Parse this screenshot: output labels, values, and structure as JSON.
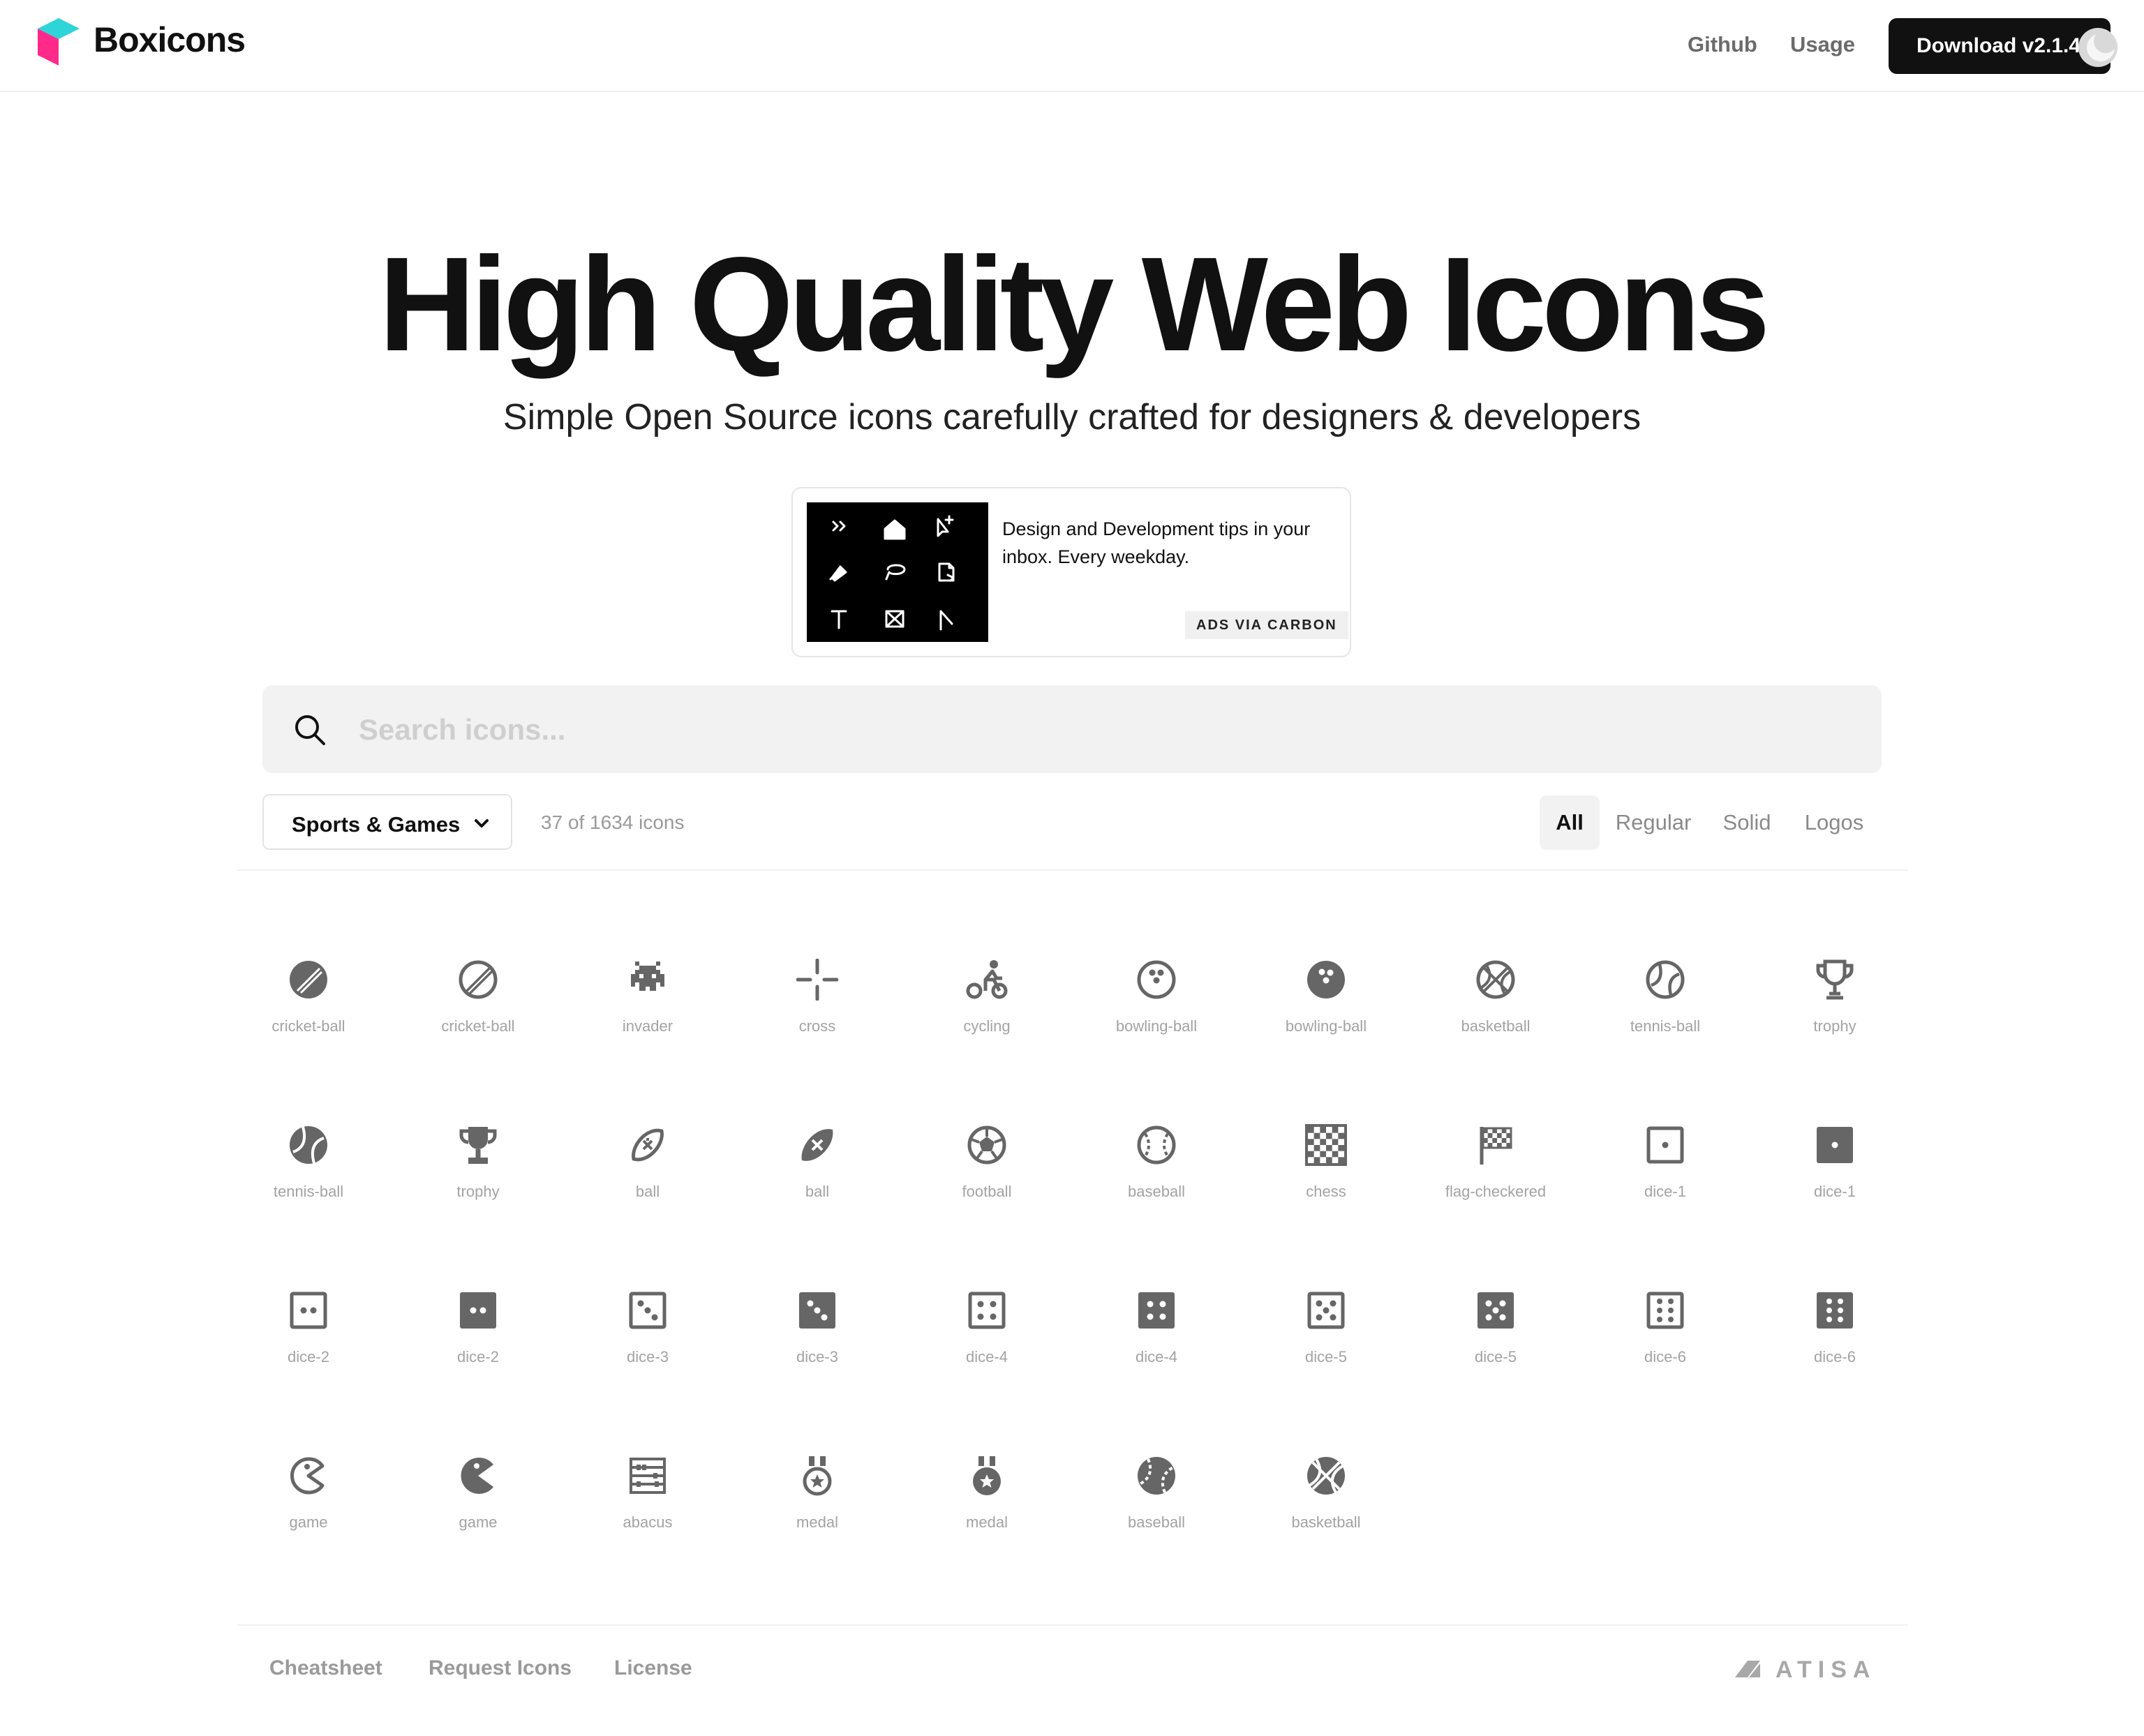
{
  "header": {
    "brand": "Boxicons",
    "nav": [
      {
        "label": "Github"
      },
      {
        "label": "Usage"
      }
    ],
    "download_label": "Download v2.1.4",
    "brand_colors": {
      "top": "#2dd4d8",
      "left": "#ff2a8a",
      "right": "#c01470"
    }
  },
  "hero": {
    "title": "High Quality Web Icons",
    "subtitle": "Simple Open Source icons carefully crafted for designers & developers"
  },
  "ad": {
    "text": "Design and Development tips in your inbox. Every weekday.",
    "badge": "ADS VIA CARBON"
  },
  "search": {
    "placeholder": "Search icons..."
  },
  "filters": {
    "category": "Sports & Games",
    "count_text": "37 of 1634 icons",
    "tabs": [
      {
        "label": "All",
        "active": true
      },
      {
        "label": "Regular",
        "active": false
      },
      {
        "label": "Solid",
        "active": false
      },
      {
        "label": "Logos",
        "active": false
      }
    ]
  },
  "icons": [
    {
      "name": "cricket-ball",
      "icon": "cricket-ball-solid-icon"
    },
    {
      "name": "cricket-ball",
      "icon": "cricket-ball-regular-icon"
    },
    {
      "name": "invader",
      "icon": "invader-icon"
    },
    {
      "name": "cross",
      "icon": "cross-icon"
    },
    {
      "name": "cycling",
      "icon": "cycling-icon"
    },
    {
      "name": "bowling-ball",
      "icon": "bowling-ball-regular-icon"
    },
    {
      "name": "bowling-ball",
      "icon": "bowling-ball-solid-icon"
    },
    {
      "name": "basketball",
      "icon": "basketball-regular-icon"
    },
    {
      "name": "tennis-ball",
      "icon": "tennis-ball-regular-icon"
    },
    {
      "name": "trophy",
      "icon": "trophy-regular-icon"
    },
    {
      "name": "tennis-ball",
      "icon": "tennis-ball-solid-icon"
    },
    {
      "name": "trophy",
      "icon": "trophy-solid-icon"
    },
    {
      "name": "ball",
      "icon": "ball-regular-icon"
    },
    {
      "name": "ball",
      "icon": "ball-solid-icon"
    },
    {
      "name": "football",
      "icon": "football-icon"
    },
    {
      "name": "baseball",
      "icon": "baseball-regular-icon"
    },
    {
      "name": "chess",
      "icon": "chess-icon"
    },
    {
      "name": "flag-checkered",
      "icon": "flag-checkered-icon"
    },
    {
      "name": "dice-1",
      "icon": "dice-1-regular-icon"
    },
    {
      "name": "dice-1",
      "icon": "dice-1-solid-icon"
    },
    {
      "name": "dice-2",
      "icon": "dice-2-regular-icon"
    },
    {
      "name": "dice-2",
      "icon": "dice-2-solid-icon"
    },
    {
      "name": "dice-3",
      "icon": "dice-3-regular-icon"
    },
    {
      "name": "dice-3",
      "icon": "dice-3-solid-icon"
    },
    {
      "name": "dice-4",
      "icon": "dice-4-regular-icon"
    },
    {
      "name": "dice-4",
      "icon": "dice-4-solid-icon"
    },
    {
      "name": "dice-5",
      "icon": "dice-5-regular-icon"
    },
    {
      "name": "dice-5",
      "icon": "dice-5-solid-icon"
    },
    {
      "name": "dice-6",
      "icon": "dice-6-regular-icon"
    },
    {
      "name": "dice-6",
      "icon": "dice-6-solid-icon"
    },
    {
      "name": "game",
      "icon": "game-regular-icon"
    },
    {
      "name": "game",
      "icon": "game-solid-icon"
    },
    {
      "name": "abacus",
      "icon": "abacus-icon"
    },
    {
      "name": "medal",
      "icon": "medal-regular-icon"
    },
    {
      "name": "medal",
      "icon": "medal-solid-icon"
    },
    {
      "name": "baseball",
      "icon": "baseball-solid-icon"
    },
    {
      "name": "basketball",
      "icon": "basketball-solid-icon"
    }
  ],
  "footer": {
    "links": [
      {
        "label": "Cheatsheet"
      },
      {
        "label": "Request Icons"
      },
      {
        "label": "License"
      }
    ],
    "sponsor": "ATISA"
  }
}
